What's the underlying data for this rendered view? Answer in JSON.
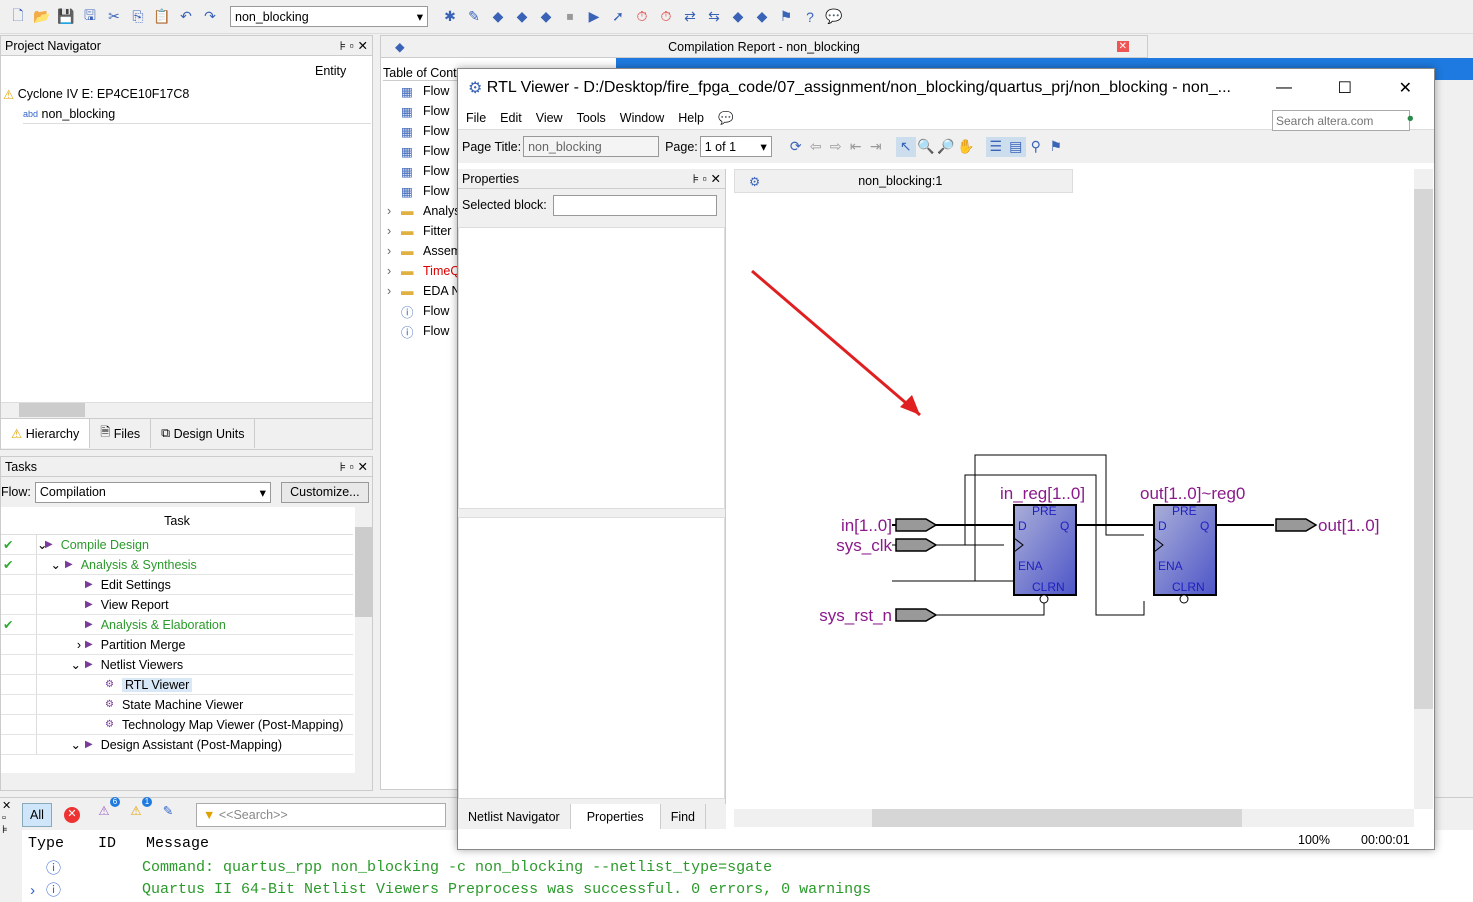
{
  "toolbar": {
    "project_select": "non_blocking"
  },
  "project_navigator": {
    "title": "Project Navigator",
    "entity_header": "Entity",
    "device": "Cyclone IV E: EP4CE10F17C8",
    "top_entity": "non_blocking",
    "tabs": [
      "Hierarchy",
      "Files",
      "Design Units"
    ]
  },
  "tasks": {
    "title": "Tasks",
    "flow_label": "Flow:",
    "flow_value": "Compilation",
    "customize": "Customize...",
    "header": "Task",
    "items": [
      {
        "label": "Compile Design",
        "done": true,
        "green": true,
        "indent": 0,
        "exp": "v"
      },
      {
        "label": "Analysis & Synthesis",
        "done": true,
        "green": true,
        "indent": 1,
        "exp": "v"
      },
      {
        "label": "Edit Settings",
        "indent": 2
      },
      {
        "label": "View Report",
        "indent": 2
      },
      {
        "label": "Analysis & Elaboration",
        "done": true,
        "green": true,
        "indent": 2
      },
      {
        "label": "Partition Merge",
        "indent": 2,
        "exp": ">"
      },
      {
        "label": "Netlist Viewers",
        "indent": 2,
        "exp": "v"
      },
      {
        "label": "RTL Viewer",
        "indent": 3,
        "selected": true
      },
      {
        "label": "State Machine Viewer",
        "indent": 3
      },
      {
        "label": "Technology Map Viewer (Post-Mapping)",
        "indent": 3
      },
      {
        "label": "Design Assistant (Post-Mapping)",
        "indent": 2,
        "exp": "v"
      }
    ]
  },
  "compilation_report": {
    "title": "Compilation Report - non_blocking",
    "toc_header": "Table of Contents",
    "items": [
      "Flow",
      "Flow",
      "Flow",
      "Flow",
      "Flow",
      "Flow",
      "Analysis",
      "Fitter",
      "Assembler",
      "TimeQuest",
      "EDA Netlist",
      "Flow",
      "Flow"
    ]
  },
  "rtl_viewer": {
    "title": "RTL Viewer - D:/Desktop/fire_fpga_code/07_assignment/non_blocking/quartus_prj/non_blocking - non_...",
    "menu": [
      "File",
      "Edit",
      "View",
      "Tools",
      "Window",
      "Help"
    ],
    "search_placeholder": "Search altera.com",
    "page_title_label": "Page Title:",
    "page_title_value": "non_blocking",
    "page_label": "Page:",
    "page_value": "1 of 1",
    "properties_title": "Properties",
    "selected_block_label": "Selected block:",
    "selected_block_value": "",
    "canvas_tab": "non_blocking:1",
    "bottom_tabs": [
      "Netlist Navigator",
      "Properties",
      "Find"
    ],
    "zoom": "100%",
    "time": "00:00:01",
    "schematic": {
      "inputs": [
        "in[1..0]",
        "sys_clk",
        "sys_rst_n"
      ],
      "output": "out[1..0]",
      "regs": [
        {
          "name": "in_reg[1..0]"
        },
        {
          "name": "out[1..0]~reg0"
        }
      ],
      "pins": {
        "pre": "PRE",
        "d": "D",
        "q": "Q",
        "ena": "ENA",
        "clrn": "CLRN"
      }
    },
    "colors": {
      "reg_fill": "#6f76cf",
      "label": "#8b1a8b",
      "arrow": "#e02020"
    }
  },
  "messages": {
    "filters": [
      "All"
    ],
    "badges": {
      "critical": "6",
      "warning": "1"
    },
    "search_placeholder": "<<Search>>",
    "columns": [
      "Type",
      "ID",
      "Message"
    ],
    "rows": [
      "Command: quartus_rpp non_blocking -c non_blocking --netlist_type=sgate",
      "Quartus II 64-Bit Netlist Viewers Preprocess was successful. 0 errors, 0 warnings"
    ]
  }
}
